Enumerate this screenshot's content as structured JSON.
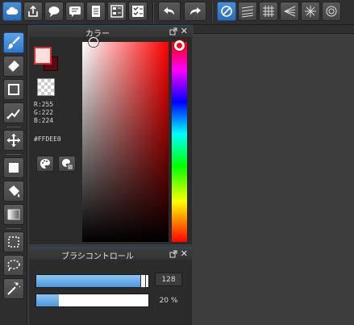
{
  "toolbar": {
    "buttons": [
      {
        "name": "cloud-icon"
      },
      {
        "name": "share-icon"
      },
      {
        "name": "comment-icon"
      },
      {
        "name": "chat-icon"
      },
      {
        "name": "document-icon"
      },
      {
        "name": "layer-list-icon"
      },
      {
        "name": "checklist-icon"
      },
      {
        "name": "undo-icon"
      },
      {
        "name": "redo-icon"
      },
      {
        "name": "no-snap-icon"
      },
      {
        "name": "parallel-lines-icon"
      },
      {
        "name": "grid-icon"
      },
      {
        "name": "perspective-icon"
      },
      {
        "name": "radial-icon"
      },
      {
        "name": "circle-snap-icon"
      }
    ]
  },
  "tools": [
    {
      "name": "brush-tool",
      "icon": "brush-icon",
      "active": true
    },
    {
      "name": "eraser-tool",
      "icon": "eraser-icon"
    },
    {
      "name": "shape-tool",
      "icon": "square-outline-icon"
    },
    {
      "name": "pen-line-tool",
      "icon": "pen-line-icon"
    },
    {
      "name": "move-tool",
      "icon": "move-arrows-icon"
    },
    {
      "name": "fill-tool",
      "icon": "square-fill-icon"
    },
    {
      "name": "bucket-tool",
      "icon": "paint-bucket-icon"
    },
    {
      "name": "gradient-tool",
      "icon": "gradient-icon"
    },
    {
      "name": "select-tool",
      "icon": "selection-rect-icon"
    },
    {
      "name": "lasso-tool",
      "icon": "lasso-icon"
    },
    {
      "name": "magic-wand-tool",
      "icon": "magic-wand-icon"
    }
  ],
  "color_panel": {
    "title": "カラー",
    "main_color": "#ffdee0",
    "sub_color": "#5a0b10",
    "r_label": "R:255",
    "g_label": "G:222",
    "b_label": "B:224",
    "hex_label": "#FFDEE0",
    "hue_color": "#ff0000"
  },
  "brush_panel": {
    "title": "ブラシコントロール",
    "size_value": "128",
    "size_fraction": 0.96,
    "opacity_value": "20 %",
    "opacity_fraction": 0.2,
    "accent": "#4f97dc"
  }
}
